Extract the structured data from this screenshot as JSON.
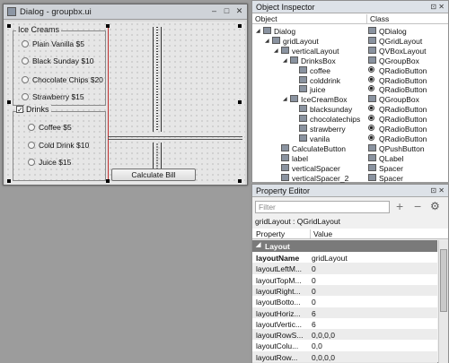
{
  "dialog": {
    "title": "Dialog - groupbx.ui",
    "ice_creams_group": "Ice Creams",
    "ice_creams": [
      "Plain Vanilla  $5",
      "Black Sunday $10",
      "Chocolate Chips  $20",
      "Strawberry  $15"
    ],
    "drinks_group": "Drinks",
    "drinks_checked": "✓",
    "drinks": [
      "Coffee  $5",
      "Cold Drink $10",
      "Juice $15"
    ],
    "calculate_button": "Calculate Bill"
  },
  "object_inspector": {
    "title": "Object Inspector",
    "columns": [
      "Object",
      "Class"
    ],
    "rows": [
      {
        "object": "Dialog",
        "class": "QDialog"
      },
      {
        "object": "gridLayout",
        "class": "QGridLayout"
      },
      {
        "object": "verticalLayout",
        "class": "QVBoxLayout"
      },
      {
        "object": "DrinksBox",
        "class": "QGroupBox"
      },
      {
        "object": "coffee",
        "class": "QRadioButton"
      },
      {
        "object": "colddrink",
        "class": "QRadioButton"
      },
      {
        "object": "juice",
        "class": "QRadioButton"
      },
      {
        "object": "IceCreamBox",
        "class": "QGroupBox"
      },
      {
        "object": "blacksunday",
        "class": "QRadioButton"
      },
      {
        "object": "chocolatechips",
        "class": "QRadioButton"
      },
      {
        "object": "strawberry",
        "class": "QRadioButton"
      },
      {
        "object": "vanila",
        "class": "QRadioButton"
      },
      {
        "object": "CalculateButton",
        "class": "QPushButton"
      },
      {
        "object": "label",
        "class": "QLabel"
      },
      {
        "object": "verticalSpacer",
        "class": "Spacer"
      },
      {
        "object": "verticalSpacer_2",
        "class": "Spacer"
      }
    ]
  },
  "property_editor": {
    "title": "Property Editor",
    "filter_placeholder": "Filter",
    "object_label": "gridLayout : QGridLayout",
    "columns": [
      "Property",
      "Value"
    ],
    "section": "Layout",
    "rows": [
      {
        "name": "layoutName",
        "value": "gridLayout"
      },
      {
        "name": "layoutLeftM...",
        "value": "0"
      },
      {
        "name": "layoutTopM...",
        "value": "0"
      },
      {
        "name": "layoutRight...",
        "value": "0"
      },
      {
        "name": "layoutBotto...",
        "value": "0"
      },
      {
        "name": "layoutHoriz...",
        "value": "6"
      },
      {
        "name": "layoutVertic...",
        "value": "6"
      },
      {
        "name": "layoutRowS...",
        "value": "0,0,0,0"
      },
      {
        "name": "layoutColu...",
        "value": "0,0"
      },
      {
        "name": "layoutRow...",
        "value": "0,0,0,0"
      }
    ]
  },
  "panel_buttons": "⊡ ✕",
  "colors": {
    "panel_title": "#dde2e8",
    "section_header": "#7a7a7a",
    "canvas": "#9c9c9c"
  }
}
